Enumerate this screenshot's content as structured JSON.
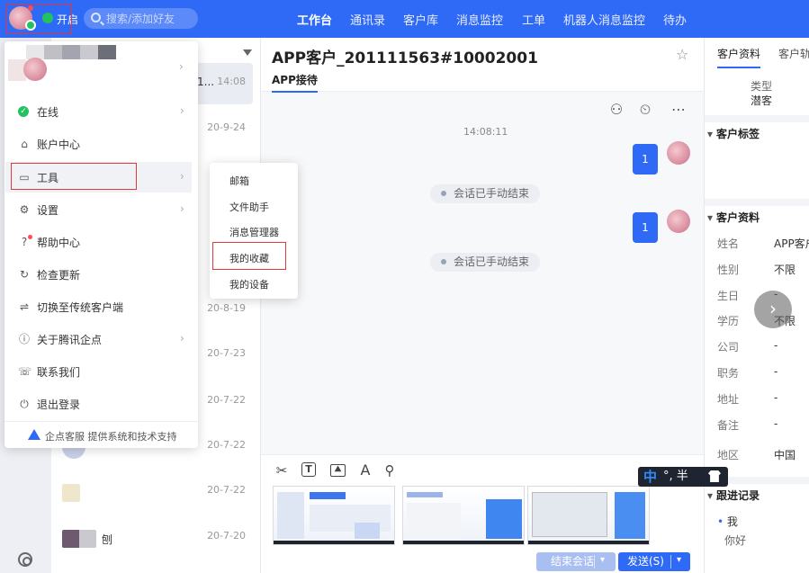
{
  "topbar": {
    "status_label": "开启",
    "search_placeholder": "搜索/添加好友",
    "nav": [
      "工作台",
      "通讯录",
      "客户库",
      "消息监控",
      "工单",
      "机器人消息监控",
      "待办"
    ],
    "accent": "#2f6af6"
  },
  "conversations": [
    {
      "name": "",
      "time": "14:08",
      "selected": true,
      "ellipsis": "1..."
    },
    {
      "name": "",
      "time": "20-9-24"
    },
    {
      "name": "",
      "time": "20-8-19"
    },
    {
      "name": "",
      "time": "20-7-23"
    },
    {
      "name": "",
      "time": "20-7-22"
    },
    {
      "name": "",
      "time": "20-7-22"
    },
    {
      "name": "",
      "time": "20-7-22"
    },
    {
      "name": "刨",
      "time": "20-7-20"
    }
  ],
  "chat": {
    "title": "APP客户_201111563#10002001",
    "subtab": "APP接待",
    "time": "14:08:11",
    "messages": [
      "1",
      "1"
    ],
    "system_messages": [
      "会话已手动结束",
      "会话已手动结束"
    ],
    "end_button": "结束会话",
    "send_button": "发送(S)"
  },
  "right_panel": {
    "tabs": [
      "客户资料",
      "客户轨"
    ],
    "type_label": "类型",
    "type_value": "潜客",
    "section_tags": "客户标签",
    "section_profile": "客户资料",
    "fields": [
      {
        "label": "姓名",
        "value": "APP客户"
      },
      {
        "label": "性别",
        "value": "不限"
      },
      {
        "label": "生日",
        "value": "-"
      },
      {
        "label": "学历",
        "value": "不限"
      },
      {
        "label": "公司",
        "value": "-"
      },
      {
        "label": "职务",
        "value": "-"
      },
      {
        "label": "地址",
        "value": "-"
      },
      {
        "label": "备注",
        "value": "-"
      },
      {
        "label": "地区",
        "value": "中国"
      }
    ],
    "section_followup": "跟进记录",
    "followup_author": "我",
    "followup_text": "你好"
  },
  "ime": {
    "mode": "中",
    "punct": "°, 半"
  },
  "menu": {
    "items": [
      {
        "label": "在线",
        "icon": "online-icon",
        "chevron": true
      },
      {
        "label": "账户中心",
        "icon": "home-icon",
        "chevron": false
      },
      {
        "label": "工具",
        "icon": "toolbox-icon",
        "chevron": true
      },
      {
        "label": "设置",
        "icon": "gear-icon",
        "chevron": true
      },
      {
        "label": "帮助中心",
        "icon": "help-icon",
        "chevron": false
      },
      {
        "label": "检查更新",
        "icon": "update-icon",
        "chevron": false
      },
      {
        "label": "切换至传统客户端",
        "icon": "switch-icon",
        "chevron": false
      },
      {
        "label": "关于腾讯企点",
        "icon": "info-icon",
        "chevron": true
      },
      {
        "label": "联系我们",
        "icon": "contact-icon",
        "chevron": false
      },
      {
        "label": "退出登录",
        "icon": "power-icon",
        "chevron": false
      }
    ],
    "footer": "企点客服 提供系统和技术支持"
  },
  "submenu": {
    "items": [
      "邮箱",
      "文件助手",
      "消息管理器",
      "我的收藏",
      "我的设备"
    ]
  }
}
